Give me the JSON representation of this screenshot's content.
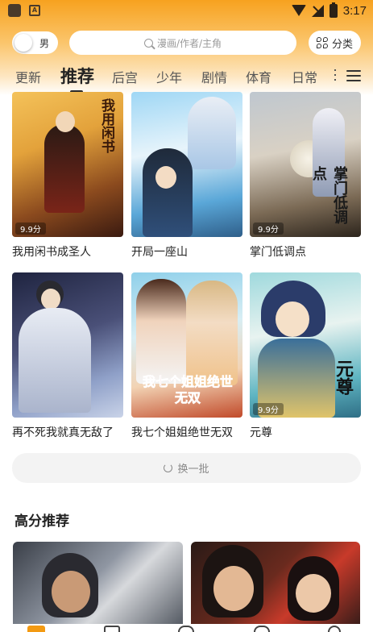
{
  "status_bar": {
    "time": "3:17",
    "app_icon_letter": "A"
  },
  "header": {
    "gender_toggle_label": "男",
    "search_placeholder": "漫画/作者/主角",
    "category_button_label": "分类"
  },
  "tabs": [
    {
      "label": "更新",
      "active": false
    },
    {
      "label": "推荐",
      "active": true
    },
    {
      "label": "后宫",
      "active": false
    },
    {
      "label": "少年",
      "active": false
    },
    {
      "label": "剧情",
      "active": false
    },
    {
      "label": "体育",
      "active": false
    },
    {
      "label": "日常",
      "active": false
    }
  ],
  "recommended": [
    {
      "title": "我用闲书成圣人",
      "score": "9.9分",
      "cover_text": "我用闲书"
    },
    {
      "title": "开局一座山",
      "score": "",
      "cover_text": ""
    },
    {
      "title": "掌门低调点",
      "score": "9.9分",
      "cover_text": "掌门低调点"
    },
    {
      "title": "再不死我就真无敌了",
      "score": "",
      "cover_text": ""
    },
    {
      "title": "我七个姐姐绝世无双",
      "score": "",
      "cover_text": "我七个姐姐绝世无双"
    },
    {
      "title": "元尊",
      "score": "9.9分",
      "cover_text": "元尊"
    }
  ],
  "refresh_button_label": "换一批",
  "high_score_section": {
    "title": "高分推荐"
  },
  "colors": {
    "accent": "#f39a12",
    "header_top": "#f7a21f"
  }
}
